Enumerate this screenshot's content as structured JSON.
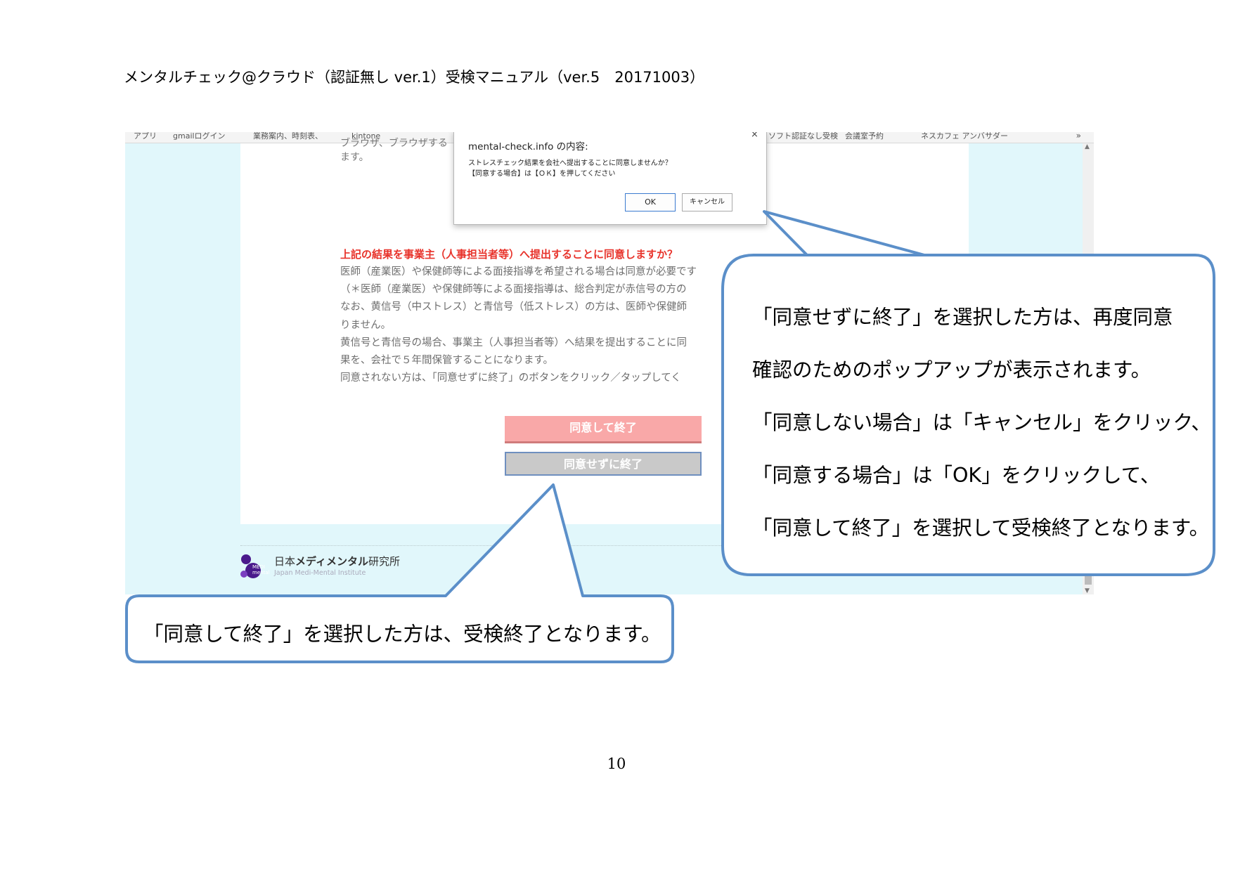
{
  "document": {
    "header": "メンタルチェック@クラウド（認証無し ver.1）受検マニュアル（ver.5　20171003）",
    "page_number": "10"
  },
  "browser": {
    "bookmarks": [
      "アプリ",
      "gmailログイン",
      "業務案内、時刻表、",
      "kintone",
      "ソフト認証なし受検",
      "会議室予約",
      "ネスカフェ アンバサダー"
    ],
    "more": "»"
  },
  "page": {
    "frag_line1": "ブラウザ、ブラウザする",
    "frag_line2": "ます。",
    "question": "上記の結果を事業主（人事担当者等）へ提出することに同意しますか？",
    "lines": [
      "医師（産業医）や保健師等による面接指導を希望される場合は同意が必要です",
      "（＊医師（産業医）や保健師等による面接指導は、総合判定が赤信号の方の",
      "なお、黄信号（中ストレス）と青信号（低ストレス）の方は、医師や保健師",
      "りません。",
      "黄信号と青信号の場合、事業主（人事担当者等）へ結果を提出することに同",
      "果を、会社で５年間保管することになります。",
      "同意されない方は、「同意せずに終了」のボタンをクリック／タップしてく"
    ],
    "btn_agree": "同意して終了",
    "btn_noagree": "同意せずに終了",
    "logo_name_prefix": "日本",
    "logo_name_bold": "メディメンタル",
    "logo_name_suffix": "研究所",
    "logo_en": "Japan Medi-Mental Institute",
    "logo_mark": "MEDI mental"
  },
  "dialog": {
    "title": "mental-check.info の内容:",
    "message_line1": "ストレスチェック結果を会社へ提出することに同意しませんか？",
    "message_line2": "【同意する場合】は【ＯＫ】を押してください",
    "ok": "OK",
    "cancel": "キャンセル",
    "close": "×"
  },
  "callouts": {
    "right": [
      "「同意せずに終了」を選択した方は、再度同意",
      "確認のためのポップアップが表示されます。",
      "「同意しない場合」は「キャンセル」をクリック、",
      "「同意する場合」は「OK」をクリックして、",
      "「同意して終了」を選択して受検終了となります。"
    ],
    "left": "「同意して終了」を選択した方は、受検終了となります。"
  },
  "colors": {
    "callout_border": "#5b8fc9",
    "question_red": "#e8332b",
    "page_bg": "#e1f7fb",
    "agree_button": "#f9a8a8",
    "noagree_button": "#c9c9c9"
  }
}
